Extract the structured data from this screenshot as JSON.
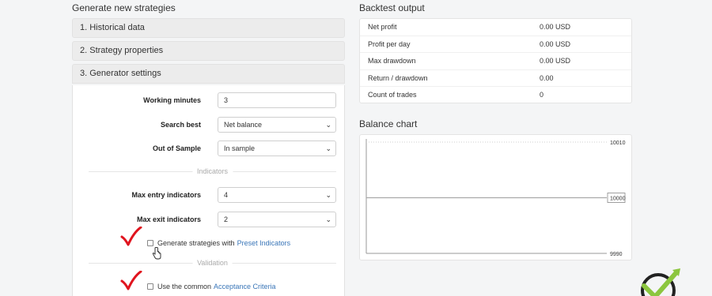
{
  "generator": {
    "title": "Generate new strategies",
    "accordion": [
      {
        "label": "1. Historical data"
      },
      {
        "label": "2. Strategy properties"
      },
      {
        "label": "3. Generator settings"
      }
    ],
    "working_minutes": {
      "label": "Working minutes",
      "value": "3"
    },
    "search_best": {
      "label": "Search best",
      "value": "Net balance"
    },
    "out_of_sample": {
      "label": "Out of Sample",
      "value": "In sample"
    },
    "indicators_divider": "Indicators",
    "max_entry": {
      "label": "Max entry indicators",
      "value": "4"
    },
    "max_exit": {
      "label": "Max exit indicators",
      "value": "2"
    },
    "preset_checkbox": {
      "text": "Generate strategies with",
      "link": "Preset Indicators"
    },
    "validation_divider": "Validation",
    "acceptance_checkbox": {
      "text": "Use the common",
      "link": "Acceptance Criteria"
    }
  },
  "backtest": {
    "title": "Backtest output",
    "rows": [
      {
        "name": "Net profit",
        "value": "0.00 USD"
      },
      {
        "name": "Profit per day",
        "value": "0.00 USD"
      },
      {
        "name": "Max drawdown",
        "value": "0.00 USD"
      },
      {
        "name": "Return / drawdown",
        "value": "0.00"
      },
      {
        "name": "Count of trades",
        "value": "0"
      }
    ]
  },
  "balance_chart": {
    "title": "Balance chart"
  },
  "chart_data": {
    "type": "line",
    "title": "Balance chart",
    "series": [
      {
        "values": [
          10000,
          10000
        ]
      }
    ],
    "ylim": [
      9990,
      10010
    ],
    "yticks": [
      "10010",
      "10000",
      "9990"
    ],
    "current_value_label": "10000",
    "grid": true
  },
  "colors": {
    "link": "#3a76b8",
    "checkmark": "#e0141e",
    "logo_green": "#8cc63f"
  }
}
